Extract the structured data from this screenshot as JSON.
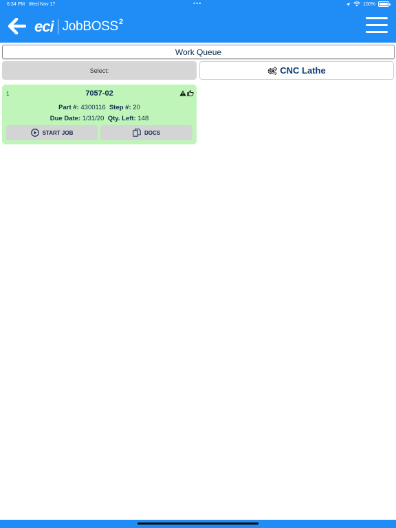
{
  "status_bar": {
    "time": "6:34 PM",
    "date": "Wed Nov 17",
    "battery": "100%"
  },
  "header": {
    "logo_eci": "eci",
    "logo_product": "JobBOSS",
    "logo_sup": "2",
    "back_icon": "back-arrow-icon",
    "menu_icon": "hamburger-menu-icon"
  },
  "page": {
    "title": "Work Queue"
  },
  "select_row": {
    "select_label": "Select:",
    "machine_label": "CNC Lathe",
    "machine_icon": "gears-icon"
  },
  "job": {
    "index": "1",
    "number": "7057-02",
    "part_label": "Part #:",
    "part_value": "4300116",
    "step_label": "Step #:",
    "step_value": "20",
    "due_label": "Due Date:",
    "due_value": "1/31/20",
    "qty_label": "Qty. Left:",
    "qty_value": "148",
    "status_icons": [
      "warning-icon",
      "thumbs-up-icon"
    ],
    "start_label": "START JOB",
    "docs_label": "DOCS"
  },
  "colors": {
    "header": "#1f8df5",
    "card": "#bff5b9",
    "text_dark": "#0d2a4d",
    "button_gray": "#d4d4d4"
  }
}
